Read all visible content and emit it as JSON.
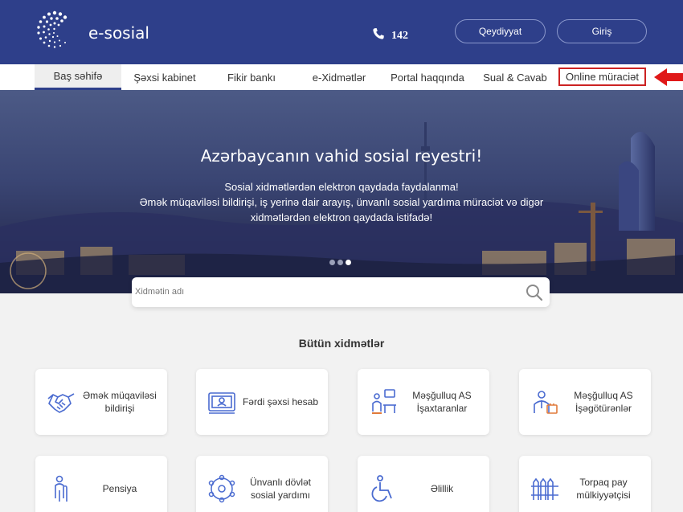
{
  "header": {
    "logo_text": "e-sosial",
    "phone": "142",
    "register_label": "Qeydiyyat",
    "login_label": "Giriş",
    "bg_color": "#2e3f8a"
  },
  "nav": {
    "items": [
      {
        "label": "Baş səhifə"
      },
      {
        "label": "Şəxsi kabinet"
      },
      {
        "label": "Fikir bankı"
      },
      {
        "label": "e-Xidmətlər"
      },
      {
        "label": "Portal haqqında"
      },
      {
        "label": "Sual & Cavab"
      },
      {
        "label": "Online müraciət"
      }
    ]
  },
  "hero": {
    "title": "Azərbaycanın vahid sosial reyestri!",
    "line1": "Sosial xidmətlərdən elektron qaydada faydalanma!",
    "line2": "Əmək müqaviləsi bildirişi, iş yerinə dair arayış, ünvanlı sosial yardıma müraciət və digər",
    "line3": "xidmətlərdən elektron qaydada istifadə!",
    "slides": 3,
    "active_slide": 3
  },
  "search": {
    "placeholder": "Xidmətin adı"
  },
  "services": {
    "title": "Bütün xidmətlər",
    "items": [
      {
        "label": "Əmək müqaviləsi bildirişi",
        "icon": "handshake-icon"
      },
      {
        "label": "Fərdi şəxsi hesab",
        "icon": "id-card-icon"
      },
      {
        "label": "Məşğulluq AS İşaxtaranlar",
        "icon": "job-seeker-icon"
      },
      {
        "label": "Məşğulluq AS İşəgötürənlər",
        "icon": "employer-icon"
      },
      {
        "label": "Pensiya",
        "icon": "elderly-person-icon"
      },
      {
        "label": "Ünvanlı dövlət sosial yardımı",
        "icon": "social-network-icon"
      },
      {
        "label": "Əlillik",
        "icon": "wheelchair-icon"
      },
      {
        "label": "Torpaq pay mülkiyyətçisi",
        "icon": "fence-icon"
      }
    ]
  },
  "colors": {
    "accent": "#2e3f8a",
    "icon": "#4a6bd0",
    "highlight": "#cc2222"
  }
}
